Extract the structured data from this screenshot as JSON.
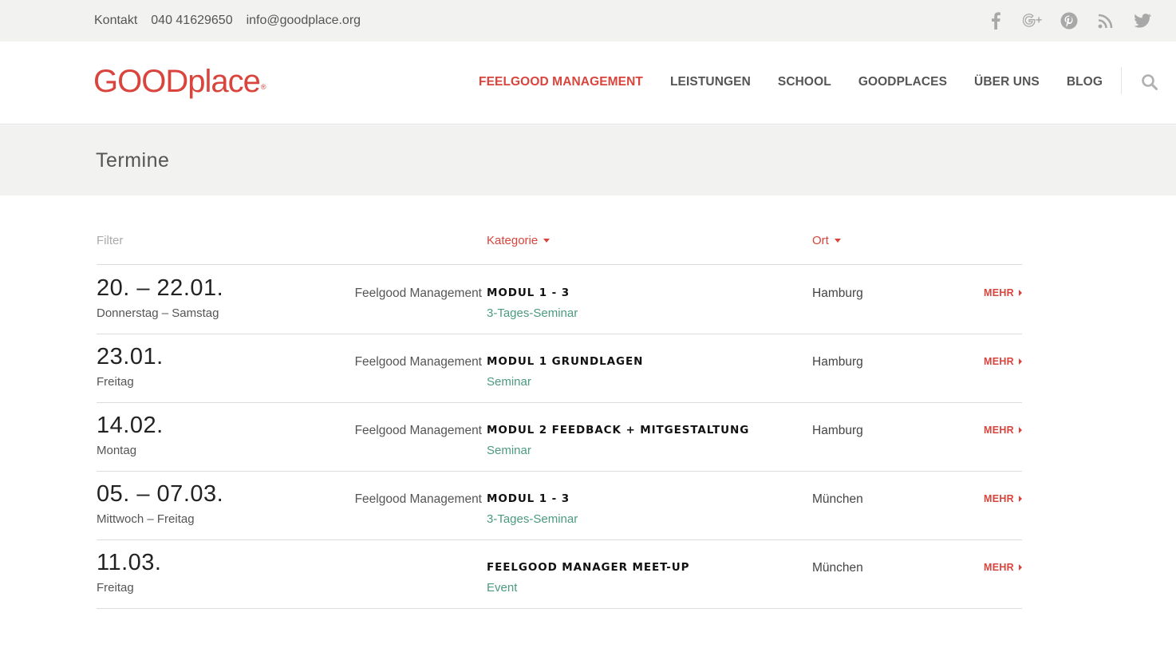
{
  "topbar": {
    "contact_label": "Kontakt",
    "phone": "040 41629650",
    "email": "info@goodplace.org",
    "social": [
      "facebook-icon",
      "google-plus-icon",
      "pinterest-icon",
      "rss-icon",
      "twitter-icon"
    ]
  },
  "header": {
    "logo_text": "GOODplace",
    "logo_mark": "®",
    "nav": [
      {
        "label": "FEELGOOD MANAGEMENT",
        "active": true
      },
      {
        "label": "LEISTUNGEN"
      },
      {
        "label": "SCHOOL"
      },
      {
        "label": "GOODPLACES"
      },
      {
        "label": "ÜBER UNS"
      },
      {
        "label": "BLOG"
      }
    ],
    "search_icon": "search-icon"
  },
  "page": {
    "title": "Termine"
  },
  "filters": {
    "label": "Filter",
    "category": "Kategorie",
    "location": "Ort"
  },
  "events": [
    {
      "date": "20. – 22.01.",
      "weekday": "Donnerstag – Samstag",
      "category": "Feelgood Management",
      "title": "MODUL 1 - 3",
      "type": "3-Tages-Seminar",
      "location": "Hamburg",
      "more": "MEHR"
    },
    {
      "date": "23.01.",
      "weekday": "Freitag",
      "category": "Feelgood Management",
      "title": "MODUL 1  GRUNDLAGEN",
      "type": "Seminar",
      "location": "Hamburg",
      "more": "MEHR"
    },
    {
      "date": "14.02.",
      "weekday": "Montag",
      "category": "Feelgood Management",
      "title": "MODUL 2  FEEDBACK + MITGESTALTUNG",
      "type": "Seminar",
      "location": "Hamburg",
      "more": "MEHR"
    },
    {
      "date": "05. – 07.03.",
      "weekday": "Mittwoch – Freitag",
      "category": "Feelgood Management",
      "title": "MODUL 1 - 3",
      "type": "3-Tages-Seminar",
      "location": "München",
      "more": "MEHR"
    },
    {
      "date": "11.03.",
      "weekday": "Freitag",
      "category": "",
      "title": "FEELGOOD MANAGER MEET-UP",
      "type": "Event",
      "location": "München",
      "more": "MEHR"
    }
  ],
  "colors": {
    "accent": "#d9443c",
    "type_text": "#4c9a80",
    "band_bg": "#f2f2f0"
  }
}
